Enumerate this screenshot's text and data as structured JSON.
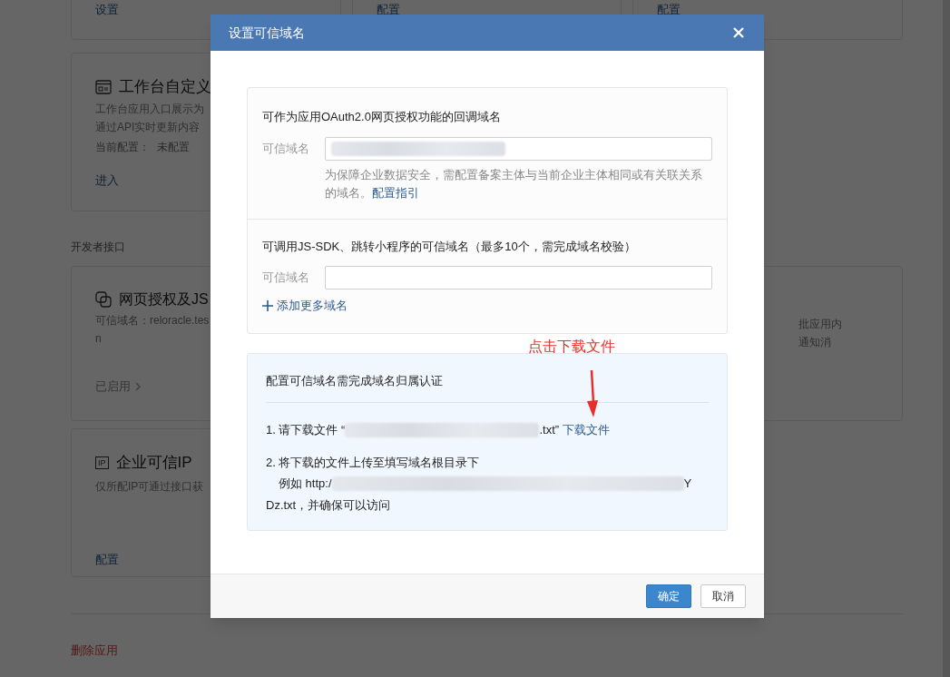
{
  "page": {
    "top_cards": [
      {
        "link": "设置"
      },
      {
        "link": "配置"
      },
      {
        "link": "配置"
      }
    ],
    "workbench_card": {
      "title": "工作台自定义",
      "description": [
        "工作台应用入口展示为",
        "通过API实时更新内容"
      ],
      "config_label": "当前配置：",
      "config_value": "未配置",
      "link": "进入"
    },
    "section_label": "开发者接口",
    "auth_card": {
      "title": "网页授权及JS",
      "lines": [
        "可信域名：reloracle.tes",
        "n"
      ],
      "status": "已启用"
    },
    "approval_card": {
      "lines": [
        "批应用内",
        "通知消"
      ]
    },
    "ip_card": {
      "icon_text": "IP",
      "title": "企业可信IP",
      "description": "仅所配IP可通过接口获",
      "link": "配置"
    },
    "delete_link": "删除应用"
  },
  "dialog": {
    "title": "设置可信域名",
    "oauth": {
      "heading": "可作为应用OAuth2.0网页授权功能的回调域名",
      "field_label": "可信域名",
      "value_redacted": true,
      "hint": "为保障企业数据安全，需配置备案主体与当前企业主体相同或有关联关系的域名。",
      "hint_link": "配置指引"
    },
    "jssdk": {
      "heading": "可调用JS-SDK、跳转小程序的可信域名（最多10个，需完成域名校验）",
      "field_label": "可信域名",
      "add_link": "添加更多域名"
    },
    "verify": {
      "title": "配置可信域名需完成域名归属认证",
      "step1_prefix": "1. 请下载文件 “",
      "step1_suffix": ".txt”",
      "step1_link": "下载文件",
      "step2": "2. 将下载的文件上传至填写域名根目录下",
      "example_prefix": "例如 http:/",
      "example_suffix": "Y",
      "example_end": "Dz.txt，并确保可以访问"
    },
    "buttons": [
      {
        "label": "确定",
        "kind": "primary"
      },
      {
        "label": "取消",
        "kind": "default"
      }
    ],
    "annotation": "点击下载文件"
  }
}
